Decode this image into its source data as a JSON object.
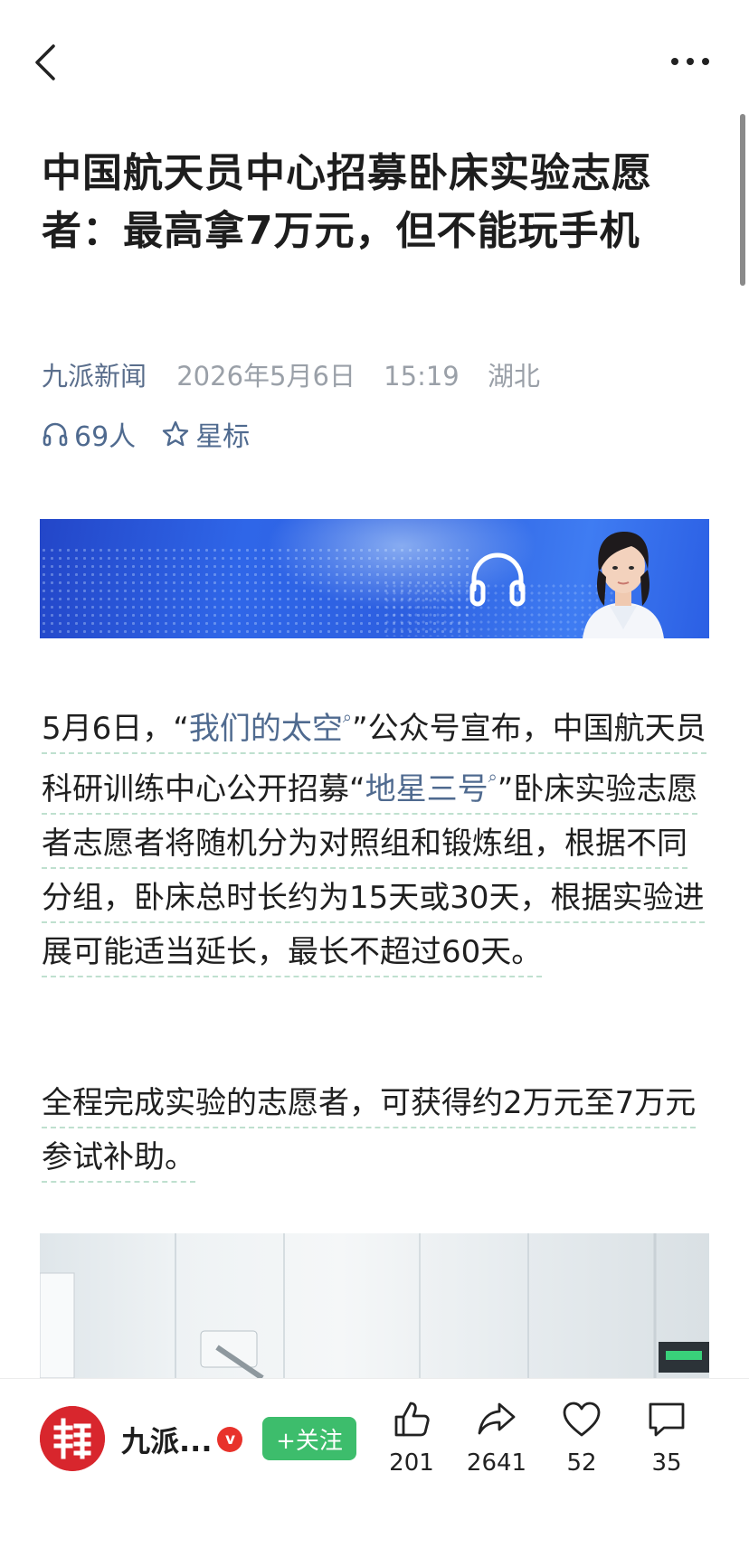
{
  "nav": {
    "back": "back",
    "more": "more options"
  },
  "article": {
    "title": "中国航天员中心招募卧床实验志愿者：最高拿7万元，但不能玩手机",
    "source": "九派新闻",
    "date": "2026年5月6日",
    "time": "15:19",
    "region": "湖北",
    "listeners": "69人",
    "star_label": "星标"
  },
  "body": {
    "p1_part1": "5月6日，“",
    "p1_link1": "我们的太空",
    "p1_part2": "”公众号宣布，中国航天员科研训练中心公开招募“",
    "p1_link2": "地星三号",
    "p1_part3": "”卧床实验志愿者志愿者将随机分为对照组和锻炼组，根据不同分组，卧床总时长约为15天或30天，根据实验进展可能适当延长，最长不超过60天。",
    "p2": "全程完成实验的志愿者，可获得约2万元至7万元参试补助。"
  },
  "bottom": {
    "account": "九派...",
    "verified": "v",
    "follow_label": "+关注",
    "likes": "201",
    "shares": "2641",
    "favorites": "52",
    "comments": "35"
  },
  "colors": {
    "accent_green": "#3dbd6c",
    "link_blue": "#4f6a8f",
    "brand_red": "#d8262d"
  }
}
